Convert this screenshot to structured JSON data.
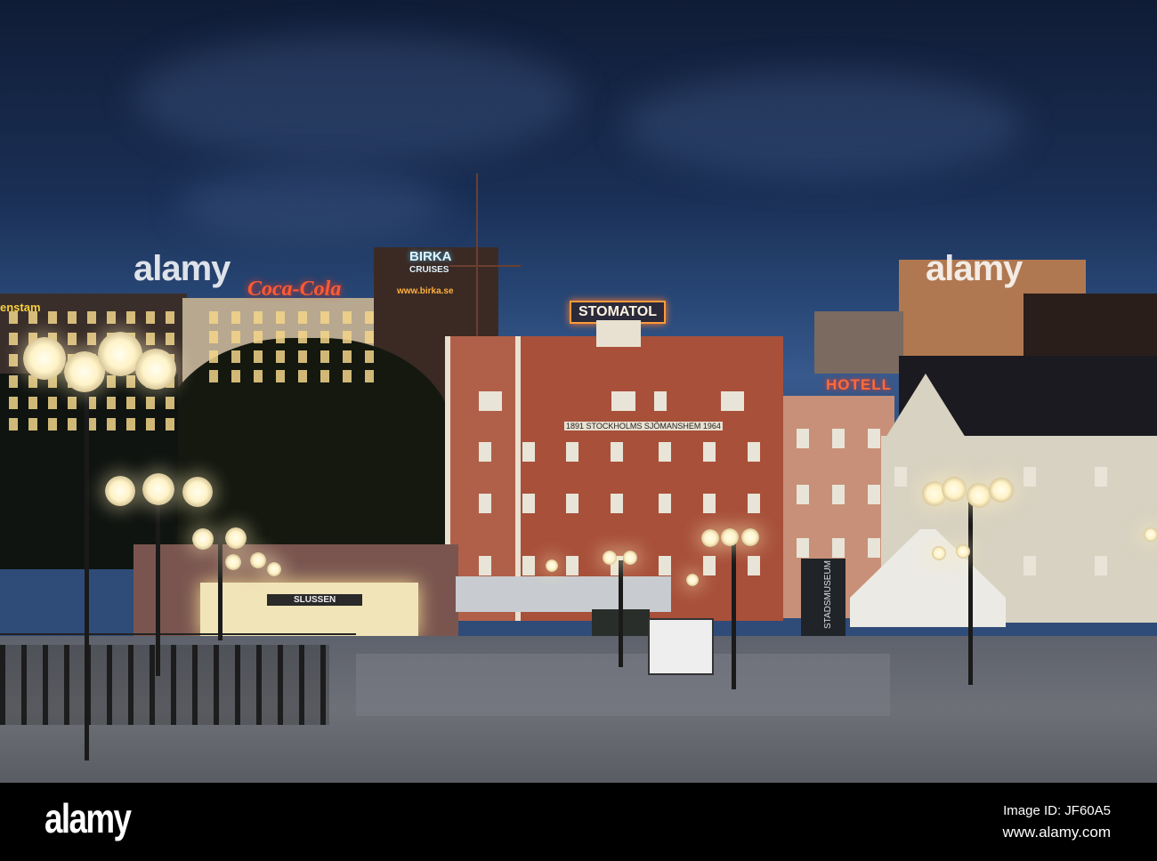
{
  "signs": {
    "coca_cola": "Coca-Cola",
    "birka": "BIRKA",
    "cruises": "CRUISES",
    "birka_url": "www.birka.se",
    "stomatol": "STOMATOL",
    "hotell": "HOTELL",
    "left_sign": "enstam",
    "sjomanshem": "1891 STOCKHOLMS SJÖMANSHEM 1964",
    "slussen": "SLUSSEN",
    "stadsmuseum": "STADSMUSEUM"
  },
  "watermark": {
    "logo": "alamy",
    "image_id": "Image ID: JF60A5",
    "url": "www.alamy.com"
  },
  "colors": {
    "sky": "#1a2f55",
    "brick": "#a8503a",
    "neon_red": "#ff4a2a",
    "neon_orange": "#ff9a3a",
    "lamp": "#fff3c8"
  }
}
